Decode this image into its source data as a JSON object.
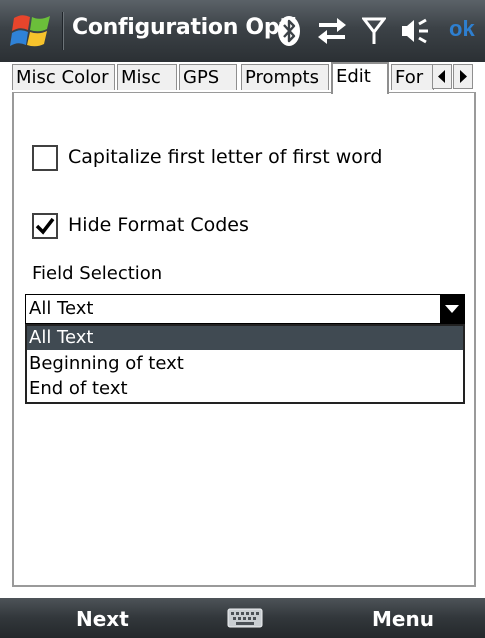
{
  "titlebar": {
    "title": "Configuration Opti",
    "ok_label": "ok",
    "icons": [
      "windows-start-icon",
      "bluetooth-icon",
      "sync-icon",
      "signal-icon",
      "volume-icon"
    ]
  },
  "tabs": [
    {
      "label": "Misc Color",
      "active": false
    },
    {
      "label": "Misc",
      "active": false
    },
    {
      "label": "GPS",
      "active": false
    },
    {
      "label": "Prompts",
      "active": false
    },
    {
      "label": "Edit",
      "active": true
    },
    {
      "label": "For",
      "active": false
    }
  ],
  "edit": {
    "capitalize_label": "Capitalize first letter of first word",
    "capitalize_checked": false,
    "hide_codes_label": "Hide Format Codes",
    "hide_codes_checked": true,
    "field_selection_label": "Field Selection",
    "field_selection_value": "All Text",
    "field_selection_options": [
      "All Text",
      "Beginning of text",
      "End of text"
    ]
  },
  "softkeys": {
    "left": "Next",
    "right": "Menu"
  },
  "colors": {
    "accent_ok": "#2e7fd0",
    "selection": "#404a52",
    "bar": "#32373b"
  }
}
